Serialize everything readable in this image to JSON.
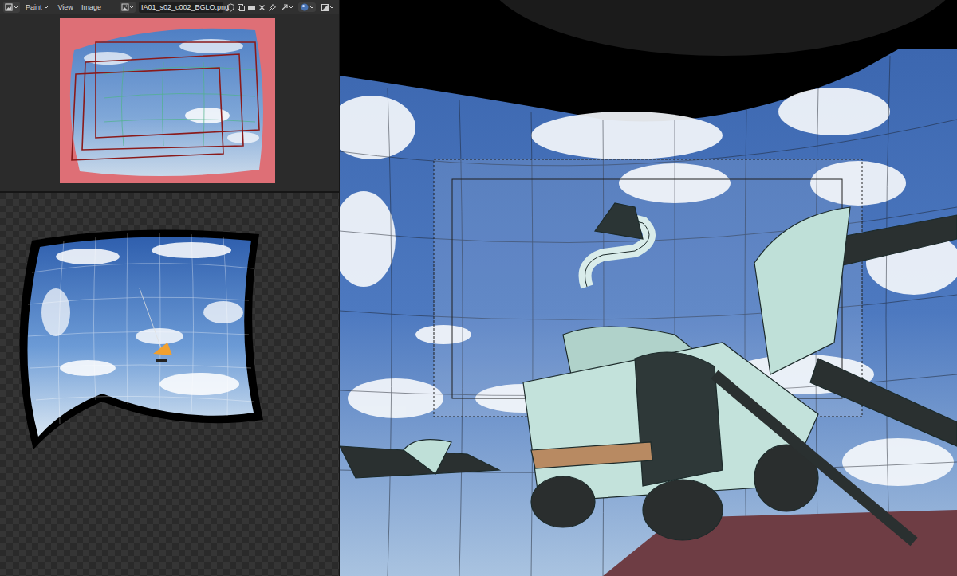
{
  "header": {
    "mode": {
      "label": "Paint"
    },
    "menus": [
      {
        "label": "View"
      },
      {
        "label": "Image"
      }
    ],
    "image_name": "IA01_s02_c002_BGLO.png"
  }
}
